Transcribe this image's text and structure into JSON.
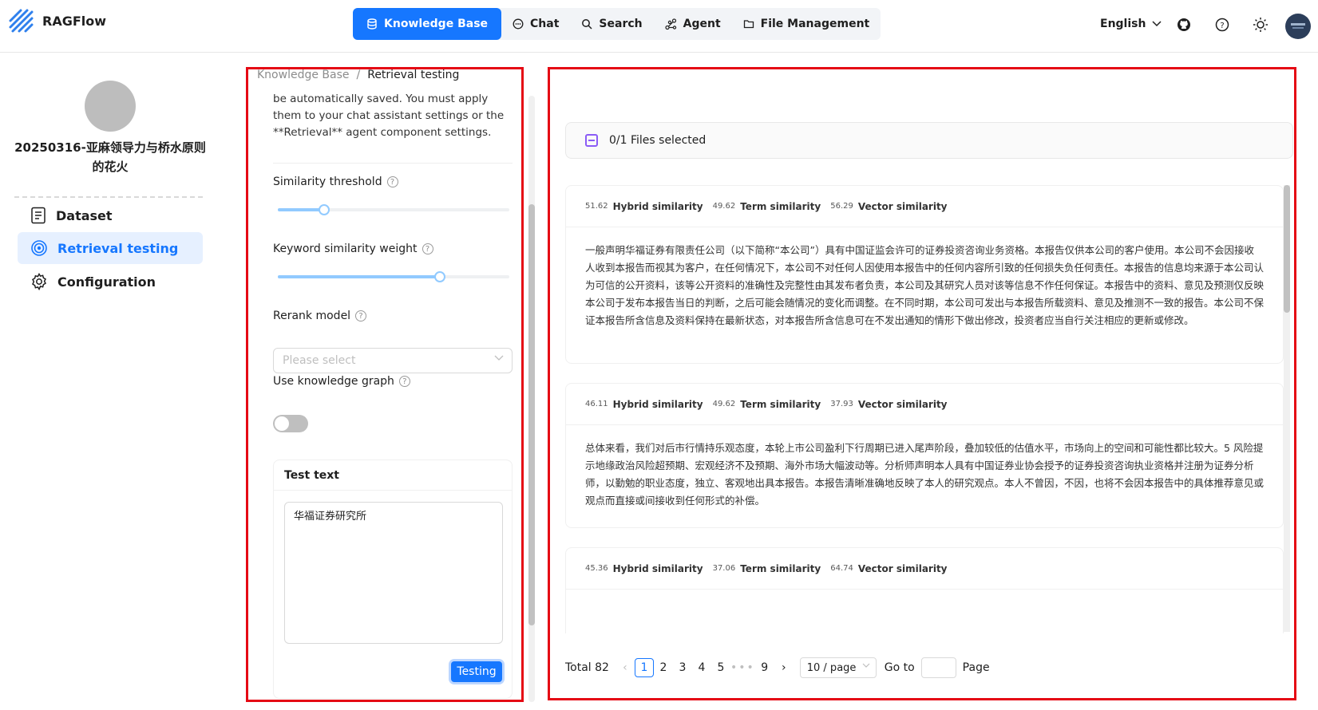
{
  "app": {
    "name": "RAGFlow"
  },
  "nav": {
    "items": [
      {
        "label": "Knowledge Base",
        "icon": "database-icon",
        "active": true
      },
      {
        "label": "Chat",
        "icon": "chat-icon",
        "active": false
      },
      {
        "label": "Search",
        "icon": "search-icon",
        "active": false
      },
      {
        "label": "Agent",
        "icon": "agent-icon",
        "active": false
      },
      {
        "label": "File Management",
        "icon": "folder-icon",
        "active": false
      }
    ]
  },
  "header": {
    "language": "English"
  },
  "sidebar": {
    "kb_name": "20250316-亚麻领导力与桥水原则的花火",
    "items": [
      {
        "label": "Dataset",
        "icon": "document-icon",
        "active": false
      },
      {
        "label": "Retrieval testing",
        "icon": "target-icon",
        "active": true
      },
      {
        "label": "Configuration",
        "icon": "gear-icon",
        "active": false
      }
    ]
  },
  "settings": {
    "breadcrumb": {
      "root": "Knowledge Base",
      "separator": "/",
      "current": "Retrieval testing"
    },
    "description": "be automatically saved. You must apply them to your chat assistant settings or the **Retrieval** agent component settings.",
    "similarity_threshold": {
      "label": "Similarity threshold",
      "value": 0.2
    },
    "keyword_weight": {
      "label": "Keyword similarity weight",
      "value": 0.7
    },
    "rerank": {
      "label": "Rerank model",
      "placeholder": "Please select"
    },
    "knowledge_graph": {
      "label": "Use knowledge graph",
      "enabled": false
    },
    "test_text": {
      "title": "Test text",
      "value": "华福证券研究所",
      "button": "Testing"
    }
  },
  "results": {
    "selection": "0/1 Files selected",
    "items": [
      {
        "hybrid": "51.62",
        "hybrid_label": "Hybrid similarity",
        "term": "49.62",
        "term_label": "Term similarity",
        "vector": "56.29",
        "vector_label": "Vector similarity",
        "text": "一般声明华福证券有限责任公司（以下简称“本公司”）具有中国证监会许可的证券投资咨询业务资格。本报告仅供本公司的客户使用。本公司不会因接收人收到本报告而视其为客户，在任何情况下，本公司不对任何人因使用本报告中的任何内容所引致的任何损失负任何责任。本报告的信息均来源于本公司认为可信的公开资料，该等公开资料的准确性及完整性由其发布者负责，本公司及其研究人员对该等信息不作任何保证。本报告中的资料、意见及预测仅反映本公司于发布本报告当日的判断，之后可能会随情况的变化而调整。在不同时期，本公司可发出与本报告所载资料、意见及推测不一致的报告。本公司不保证本报告所含信息及资料保持在最新状态，对本报告所含信息可在不发出通知的情形下做出修改，投资者应当自行关注相应的更新或修改。"
      },
      {
        "hybrid": "46.11",
        "hybrid_label": "Hybrid similarity",
        "term": "49.62",
        "term_label": "Term similarity",
        "vector": "37.93",
        "vector_label": "Vector similarity",
        "text": "总体来看，我们对后市行情持乐观态度，本轮上市公司盈利下行周期已进入尾声阶段，叠加较低的估值水平，市场向上的空间和可能性都比较大。5 风险提示地缘政治风险超预期、宏观经济不及预期、海外市场大幅波动等。分析师声明本人具有中国证券业协会授予的证券投资咨询执业资格并注册为证券分析师，以勤勉的职业态度，独立、客观地出具本报告。本报告清晰准确地反映了本人的研究观点。本人不曾因，不因，也将不会因本报告中的具体推荐意见或观点而直接或间接收到任何形式的补偿。"
      },
      {
        "hybrid": "45.36",
        "hybrid_label": "Hybrid similarity",
        "term": "37.06",
        "term_label": "Term similarity",
        "vector": "64.74",
        "vector_label": "Vector similarity",
        "text": ""
      }
    ]
  },
  "pagination": {
    "total": "Total 82",
    "pages": [
      "1",
      "2",
      "3",
      "4",
      "5"
    ],
    "ellipsis": "•••",
    "last": "9",
    "current": "1",
    "page_size": "10 / page",
    "goto": "Go to",
    "page_word": "Page"
  },
  "colors": {
    "accent": "#1677ff",
    "highlight_border": "#e50914",
    "checkbox": "#8b5cf6"
  }
}
